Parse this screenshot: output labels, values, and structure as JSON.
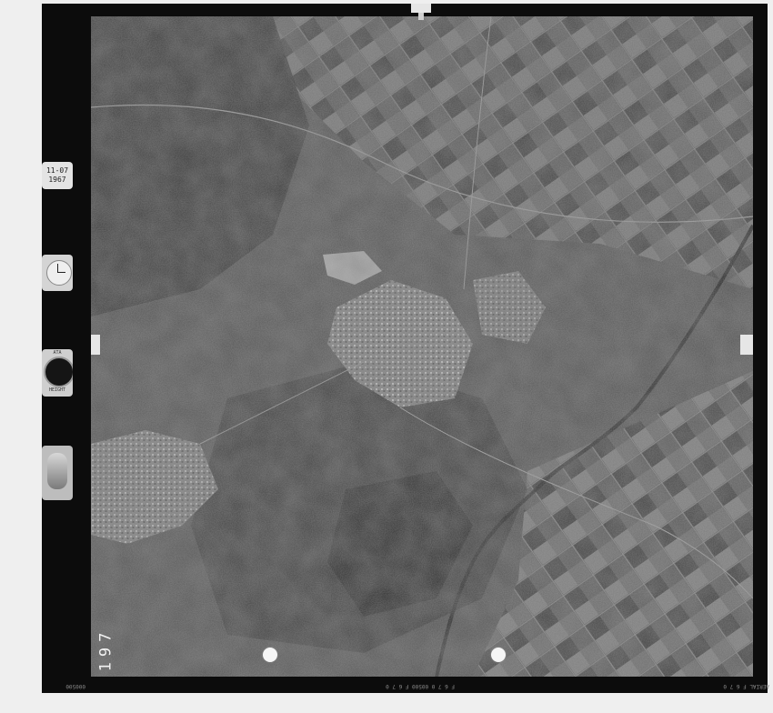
{
  "frame": {
    "number": "197",
    "date_line1": "11-07",
    "date_line2": "1967",
    "altimeter_top": "ATA",
    "altimeter_bottom": "HEIGHT",
    "film_code_left": "000500",
    "film_code_center": "F 6 7 0  00500  F 6 7 0",
    "film_code_right": "AERIAL  F 6 7 0"
  },
  "colors": {
    "film_border": "#0c0c0c",
    "paper": "#efefef",
    "photo_base": "#4a4a4a"
  }
}
